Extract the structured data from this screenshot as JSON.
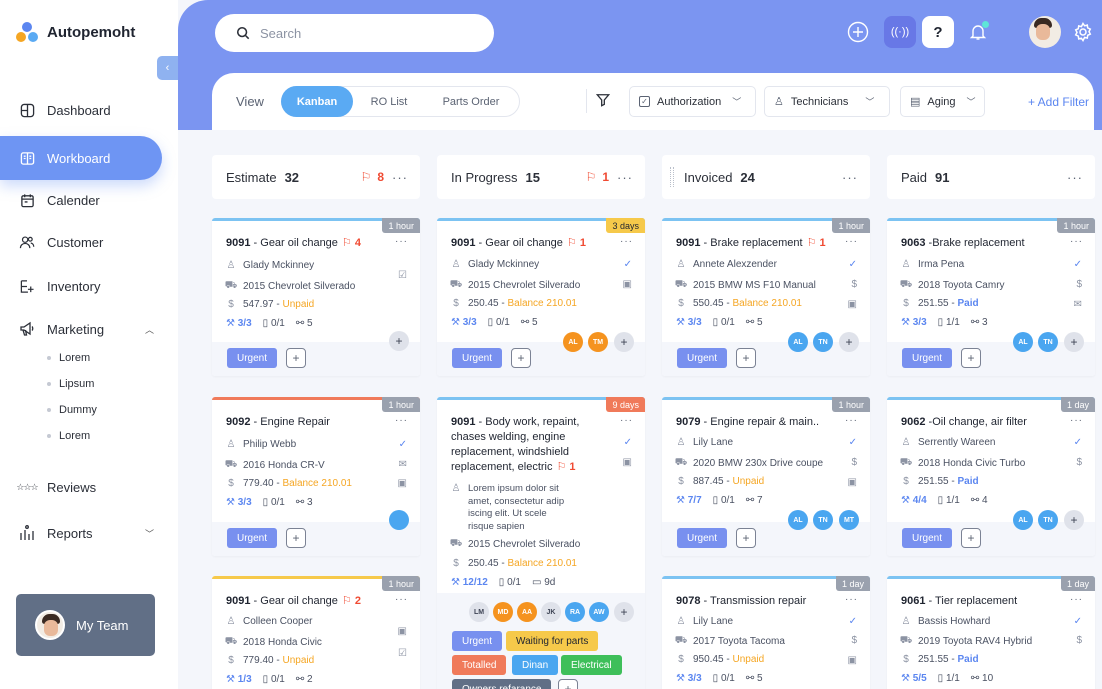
{
  "app": {
    "name": "Autopemoht"
  },
  "sidebar": {
    "collapse_glyph": "‹",
    "items": [
      {
        "label": "Dashboard",
        "icon": "dashboard-icon"
      },
      {
        "label": "Workboard",
        "icon": "workboard-icon",
        "active": true
      },
      {
        "label": "Calender",
        "icon": "calendar-icon"
      },
      {
        "label": "Customer",
        "icon": "customer-icon"
      },
      {
        "label": "Inventory",
        "icon": "inventory-icon"
      },
      {
        "label": "Marketing",
        "icon": "marketing-icon"
      },
      {
        "label": "Reviews",
        "icon": "reviews-icon"
      },
      {
        "label": "Reports",
        "icon": "reports-icon"
      }
    ],
    "marketing_sub": [
      "Lorem",
      "Lipsum",
      "Dummy",
      "Lorem"
    ],
    "team_label": "My Team"
  },
  "header": {
    "search_placeholder": "Search",
    "help_glyph": "?"
  },
  "filters": {
    "view_label": "View",
    "views": [
      "Kanban",
      "RO List",
      "Parts Order"
    ],
    "active_view": "Kanban",
    "dropdowns": [
      "Authorization",
      "Technicians",
      "Aging"
    ],
    "add_filter": "+ Add Filter"
  },
  "columns": [
    {
      "title": "Estimate",
      "count": "32",
      "flags": "8"
    },
    {
      "title": "In Progress",
      "count": "15",
      "flags": "1"
    },
    {
      "title": "Invoiced",
      "count": "24",
      "flags": ""
    },
    {
      "title": "Paid",
      "count": "91",
      "flags": ""
    }
  ],
  "cards": {
    "c0_0": {
      "age": "1 hour",
      "num": "9091",
      "title": " - Gear oil change",
      "flag": "4",
      "customer": "Glady Mckinney",
      "vehicle": "2015 Chevrolet Silverado",
      "amount": "547.97 - ",
      "status": "Unpaid",
      "tasks": "3/3",
      "docs": "0/1",
      "links": "5",
      "tag": "Urgent"
    },
    "c0_1": {
      "age": "1 hour",
      "num": "9092",
      "title": " - Engine Repair",
      "customer": "Philip Webb",
      "vehicle": "2016 Honda CR-V",
      "amount": "779.40 - ",
      "status": "Balance 210.01",
      "tasks": "3/3",
      "docs": "0/1",
      "links": "3",
      "tag": "Urgent"
    },
    "c0_2": {
      "age": "1 hour",
      "num": "9091",
      "title": " - Gear oil change",
      "flag": "2",
      "customer": "Colleen Cooper",
      "vehicle": "2018 Honda Civic",
      "amount": "779.40 - ",
      "status": "Unpaid",
      "tasks": "1/3",
      "docs": "0/1",
      "links": "2"
    },
    "c1_0": {
      "age": "3 days",
      "num": "9091",
      "title": " - Gear oil change",
      "flag": "1",
      "customer": "Glady Mckinney",
      "vehicle": "2015 Chevrolet Silverado",
      "amount": "250.45 - ",
      "status": "Balance 210.01",
      "tasks": "3/3",
      "docs": "0/1",
      "links": "5",
      "tag": "Urgent",
      "avatars": [
        "AL",
        "TM"
      ]
    },
    "c1_1": {
      "age": "9 days",
      "num": "9091",
      "title_lines": [
        "- Body work, repaint,",
        "chases welding, engine",
        "replacement, windshield",
        "replacement, electric"
      ],
      "flag": "1",
      "notes": [
        "Lorem ipsum dolor sit",
        "amet,  consectetur adip",
        "iscing elit.  Ut scele",
        "risque sapien"
      ],
      "vehicle": "2015 Chevrolet Silverado",
      "amount": "250.45 - ",
      "status": "Balance 210.01",
      "tasks": "12/12",
      "docs": "0/1",
      "days": "9d",
      "avatars": [
        "LM",
        "MD",
        "AA",
        "JK",
        "RA",
        "AW"
      ],
      "tags": [
        "Urgent",
        "Waiting for parts",
        "Totalled",
        "Dinan",
        "Electrical",
        "Owners refarance"
      ]
    },
    "c2_0": {
      "age": "1 hour",
      "num": "9091",
      "title": " - Brake replacement",
      "flag": "1",
      "customer": "Annete Alexzender",
      "vehicle": "2015 BMW MS F10 Manual",
      "amount": "550.45 - ",
      "status": "Balance 210.01",
      "tasks": "3/3",
      "docs": "0/1",
      "links": "5",
      "tag": "Urgent",
      "avatars": [
        "AL",
        "TN"
      ]
    },
    "c2_1": {
      "age": "1 hour",
      "num": "9079",
      "title": " - Engine repair & main..",
      "customer": "Lily Lane",
      "vehicle": "2020 BMW 230x Drive coupe",
      "amount": "887.45 - ",
      "status": "Unpaid",
      "tasks": "7/7",
      "docs": "0/1",
      "links": "7",
      "tag": "Urgent",
      "avatars": [
        "AL",
        "TN",
        "MT"
      ]
    },
    "c2_2": {
      "age": "1 day",
      "num": "9078",
      "title": " - Transmission repair",
      "customer": "Lily Lane",
      "vehicle": "2017 Toyota Tacoma",
      "amount": "950.45 - ",
      "status": "Unpaid",
      "tasks": "3/3",
      "docs": "0/1",
      "links": "5"
    },
    "c3_0": {
      "age": "1 hour",
      "num": "9063",
      "title": " -Brake replacement",
      "customer": "Irma Pena",
      "vehicle": "2018 Toyota Camry",
      "amount": "251.55 - ",
      "status": "Paid",
      "tasks": "3/3",
      "docs": "1/1",
      "links": "3",
      "tag": "Urgent",
      "avatars": [
        "AL",
        "TN"
      ]
    },
    "c3_1": {
      "age": "1 day",
      "num": "9062",
      "title": " -Oil change, air filter",
      "customer": "Serrently Wareen",
      "vehicle": "2018 Honda Civic Turbo",
      "amount": "251.55 - ",
      "status": "Paid",
      "tasks": "4/4",
      "docs": "1/1",
      "links": "4",
      "tag": "Urgent",
      "avatars": [
        "AL",
        "TN"
      ]
    },
    "c3_2": {
      "age": "1 day",
      "num": "9061",
      "title": " - Tier replacement",
      "customer": "Bassis Howhard",
      "vehicle": "2019 Toyota RAV4 Hybrid",
      "amount": "251.55 - ",
      "status": "Paid",
      "tasks": "5/5",
      "docs": "1/1",
      "links": "10"
    }
  },
  "colors": {
    "accent": "#7b95f1",
    "active_nav": "#6e95f3",
    "flag": "#f04a32",
    "unpaid": "#f5a623",
    "paid": "#5b86f0"
  }
}
